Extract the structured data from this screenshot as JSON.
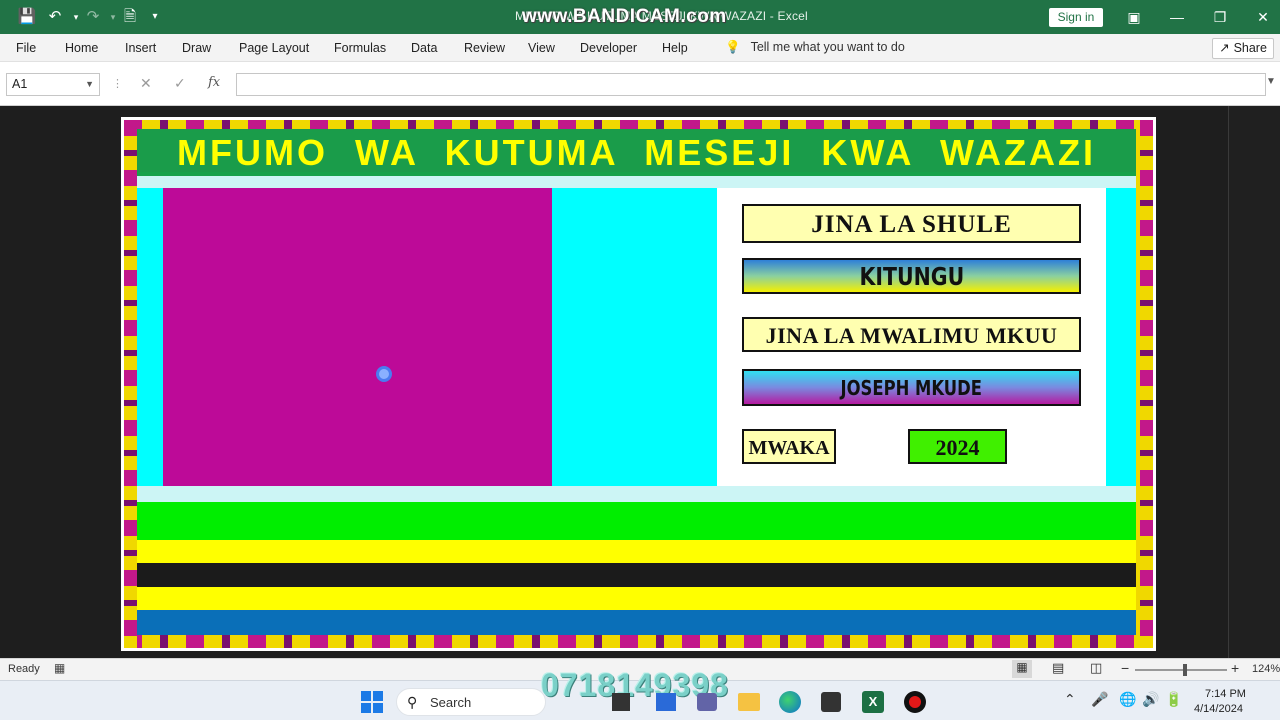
{
  "titlebar": {
    "title": "MFUMO WA KUTUMA MESEJI KWA WAZAZI - Excel",
    "watermark": "www.BANDICAM.com",
    "sign_in": "Sign in"
  },
  "menu": {
    "items": [
      "File",
      "Home",
      "Insert",
      "Draw",
      "Page Layout",
      "Formulas",
      "Data",
      "Review",
      "View",
      "Developer",
      "Help"
    ],
    "tell_me": "Tell me what you want to do",
    "share": "Share"
  },
  "formula_bar": {
    "name_box": "A1",
    "fx": "fx",
    "value": ""
  },
  "dashboard": {
    "title": "MFUMO WA KUTUMA  MESEJI KWA WAZAZI",
    "school_label": "JINA  LA  SHULE",
    "school_value": "KITUNGU",
    "head_label": "JINA  LA  MWALIMU  MKUU",
    "head_value": "JOSEPH  MKUDE",
    "year_label": "MWAKA",
    "year_value": "2024"
  },
  "status_bar": {
    "status": "Ready",
    "zoom": "124%"
  },
  "taskbar": {
    "search": "Search",
    "overlay_phone": "0718149398",
    "time": "7:14 PM",
    "date": "4/14/2024"
  },
  "colors": {
    "excel_green": "#217346",
    "title_band": "#1a9c4a",
    "title_text": "#ffff00",
    "magenta": "#bd0a98",
    "cyan": "#00ffff"
  }
}
